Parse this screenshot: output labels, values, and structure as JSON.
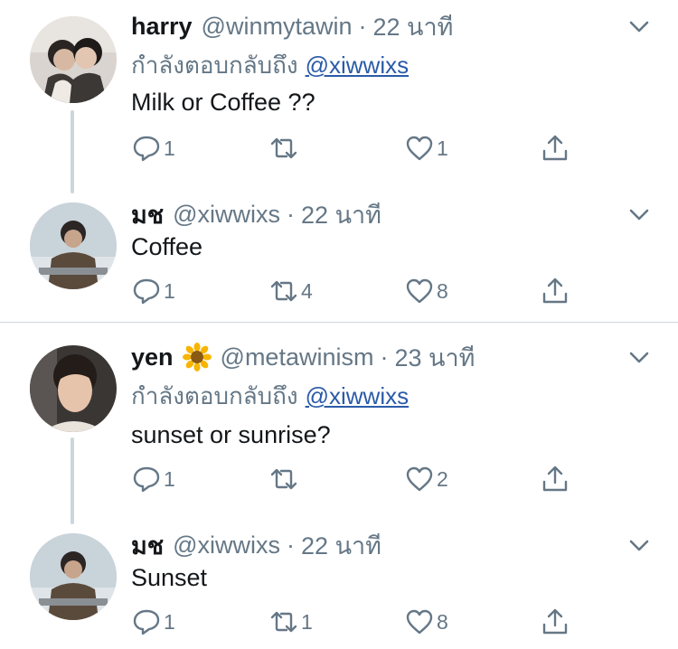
{
  "tweets": [
    {
      "name": "harry",
      "handle": "@winmytawin",
      "separator": "·",
      "time": "22 นาที",
      "replying_prefix": "กำลังตอบกลับถึง",
      "replying_to": "@xiwwixs",
      "text": "Milk or Coffee ??",
      "reply_count": "1",
      "retweet_count": "",
      "like_count": "1"
    },
    {
      "name": "มช",
      "handle": "@xiwwixs",
      "separator": "·",
      "time": "22 นาที",
      "text": "Coffee",
      "reply_count": "1",
      "retweet_count": "4",
      "like_count": "8"
    },
    {
      "name": "yen",
      "name_emoji": "sunflower-emoji",
      "handle": "@metawinism",
      "separator": "·",
      "time": "23 นาที",
      "replying_prefix": "กำลังตอบกลับถึง",
      "replying_to": "@xiwwixs",
      "text": "sunset or sunrise?",
      "reply_count": "1",
      "retweet_count": "",
      "like_count": "2"
    },
    {
      "name": "มช",
      "handle": "@xiwwixs",
      "separator": "·",
      "time": "22 นาที",
      "text": "Sunset",
      "reply_count": "1",
      "retweet_count": "1",
      "like_count": "8"
    }
  ],
  "icons": {
    "reply": "reply-icon",
    "retweet": "retweet-icon",
    "like": "heart-icon",
    "share": "share-icon",
    "more": "chevron-down-icon"
  },
  "colors": {
    "text": "#14171a",
    "secondary": "#657786",
    "thread_line": "#ccd6dd",
    "mention": "#2b5ba8"
  }
}
